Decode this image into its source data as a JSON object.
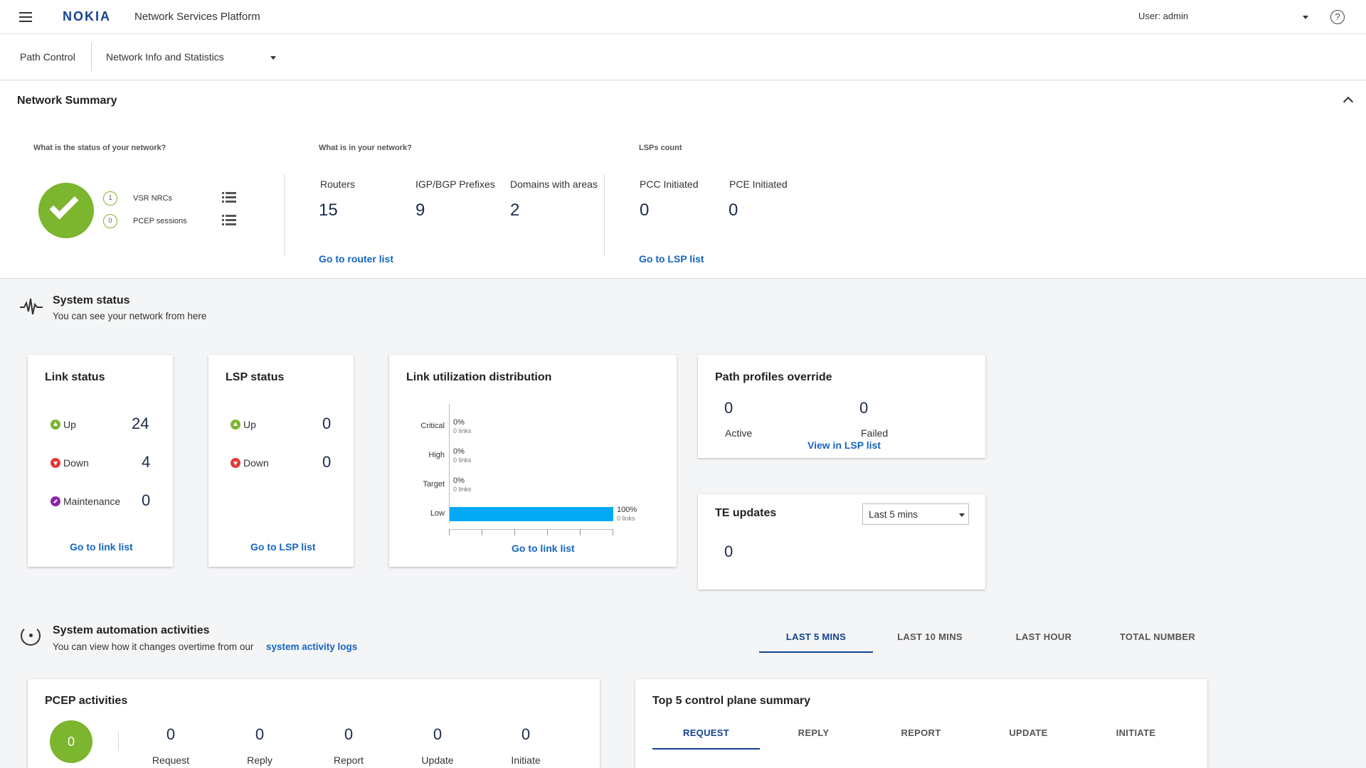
{
  "header": {
    "brand": "NOKIA",
    "app_title": "Network Services Platform",
    "user_label": "User: admin",
    "help_glyph": "?"
  },
  "nav": {
    "path_label": "Path Control",
    "selected_view": "Network Info and Statistics"
  },
  "summary": {
    "title": "Network Summary",
    "status_question": "What is the status of your network?",
    "vsr_count": "1",
    "vsr_label": "VSR NRCs",
    "pcep_count": "0",
    "pcep_label": "PCEP sessions",
    "network_question": "What is in your network?",
    "routers_label": "Routers",
    "routers_value": "15",
    "prefixes_label": "IGP/BGP Prefixes",
    "prefixes_value": "9",
    "domains_label": "Domains with areas",
    "domains_value": "2",
    "router_link": "Go to router list",
    "lsp_question": "LSPs count",
    "pcc_label": "PCC Initiated",
    "pcc_value": "0",
    "pce_label": "PCE Initiated",
    "pce_value": "0",
    "lsp_link": "Go to LSP list"
  },
  "system_status": {
    "title": "System status",
    "subtitle": "You can see your network from here"
  },
  "link_status": {
    "title": "Link status",
    "up_label": "Up",
    "up_value": "24",
    "down_label": "Down",
    "down_value": "4",
    "maint_label": "Maintenance",
    "maint_value": "0",
    "link": "Go to link list"
  },
  "lsp_status": {
    "title": "LSP status",
    "up_label": "Up",
    "up_value": "0",
    "down_label": "Down",
    "down_value": "0",
    "link": "Go to LSP list"
  },
  "link_util": {
    "title": "Link utilization distribution",
    "link": "Go to link list"
  },
  "chart_data": {
    "type": "bar",
    "orientation": "horizontal",
    "title": "Link utilization distribution",
    "categories": [
      "Critical",
      "High",
      "Target",
      "Low"
    ],
    "values": [
      0,
      0,
      0,
      100
    ],
    "value_labels": [
      "0%",
      "0%",
      "0%",
      "100%"
    ],
    "sub_labels": [
      "0 links",
      "0 links",
      "0 links",
      "0 links"
    ],
    "xlim": [
      0,
      100
    ],
    "bar_color": "#03a9f4",
    "grid": false
  },
  "path_profiles": {
    "title": "Path profiles override",
    "active_value": "0",
    "active_label": "Active",
    "failed_value": "0",
    "failed_label": "Failed",
    "link": "View in LSP list"
  },
  "te_updates": {
    "title": "TE updates",
    "range": "Last 5 mins",
    "value": "0"
  },
  "automation": {
    "title": "System automation activities",
    "subtitle": "You can view how it changes overtime from our",
    "subtitle_link": "system activity logs",
    "tabs": [
      "LAST 5 MINS",
      "LAST 10 MINS",
      "LAST HOUR",
      "TOTAL NUMBER"
    ]
  },
  "pcep": {
    "title": "PCEP activities",
    "total": "0",
    "items": [
      {
        "label": "Request",
        "value": "0"
      },
      {
        "label": "Reply",
        "value": "0"
      },
      {
        "label": "Report",
        "value": "0"
      },
      {
        "label": "Update",
        "value": "0"
      },
      {
        "label": "Initiate",
        "value": "0"
      }
    ]
  },
  "control_plane": {
    "title": "Top 5 control plane summary",
    "tabs": [
      "REQUEST",
      "REPLY",
      "REPORT",
      "UPDATE",
      "INITIATE"
    ]
  },
  "colors": {
    "accent": "#124191",
    "link": "#1565c0",
    "ok": "#7cb52e",
    "down": "#e53935",
    "maintenance": "#8e24aa",
    "bar": "#03a9f4"
  }
}
